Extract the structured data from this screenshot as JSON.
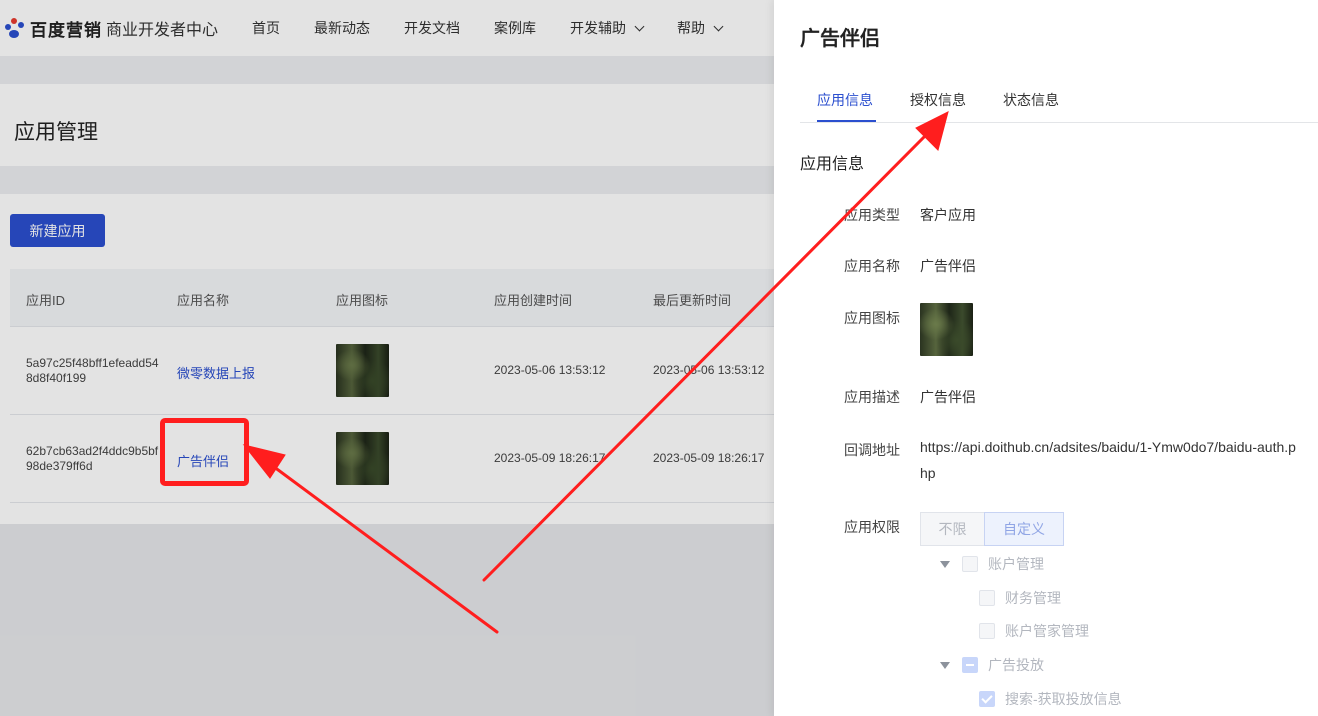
{
  "header": {
    "brand": "百度营销",
    "subtitle": "商业开发者中心",
    "nav": [
      "首页",
      "最新动态",
      "开发文档",
      "案例库",
      "开发辅助",
      "帮助"
    ]
  },
  "page": {
    "title": "应用管理",
    "new_button": "新建应用"
  },
  "table": {
    "columns": [
      "应用ID",
      "应用名称",
      "应用图标",
      "应用创建时间",
      "最后更新时间"
    ],
    "rows": [
      {
        "id": "5a97c25f48bff1efeadd548d8f40f199",
        "name": "微零数据上报",
        "created": "2023-05-06 13:53:12",
        "updated": "2023-05-06 13:53:12"
      },
      {
        "id": "62b7cb63ad2f4ddc9b5bf98de379ff6d",
        "name": "广告伴侣",
        "created": "2023-05-09 18:26:17",
        "updated": "2023-05-09 18:26:17"
      }
    ]
  },
  "drawer": {
    "title": "广告伴侣",
    "tabs": [
      "应用信息",
      "授权信息",
      "状态信息"
    ],
    "active_tab": "应用信息",
    "section_title": "应用信息",
    "fields": {
      "type_label": "应用类型",
      "type_value": "客户应用",
      "name_label": "应用名称",
      "name_value": "广告伴侣",
      "icon_label": "应用图标",
      "desc_label": "应用描述",
      "desc_value": "广告伴侣",
      "callback_label": "回调地址",
      "callback_value": "https://api.doithub.cn/adsites/baidu/1-Ymw0do7/baidu-auth.php",
      "perm_label": "应用权限"
    },
    "permission_modes": [
      "不限",
      "自定义"
    ],
    "selected_mode": "自定义",
    "tree": [
      {
        "label": "账户管理",
        "level": 0,
        "state": "unchecked"
      },
      {
        "label": "财务管理",
        "level": 1,
        "state": "unchecked"
      },
      {
        "label": "账户管家管理",
        "level": 1,
        "state": "unchecked"
      },
      {
        "label": "广告投放",
        "level": 0,
        "state": "partial"
      },
      {
        "label": "搜索-获取投放信息",
        "level": 1,
        "state": "checked"
      }
    ]
  },
  "colors": {
    "primary": "#2b4fcf",
    "annotation": "#ff1e1e"
  }
}
